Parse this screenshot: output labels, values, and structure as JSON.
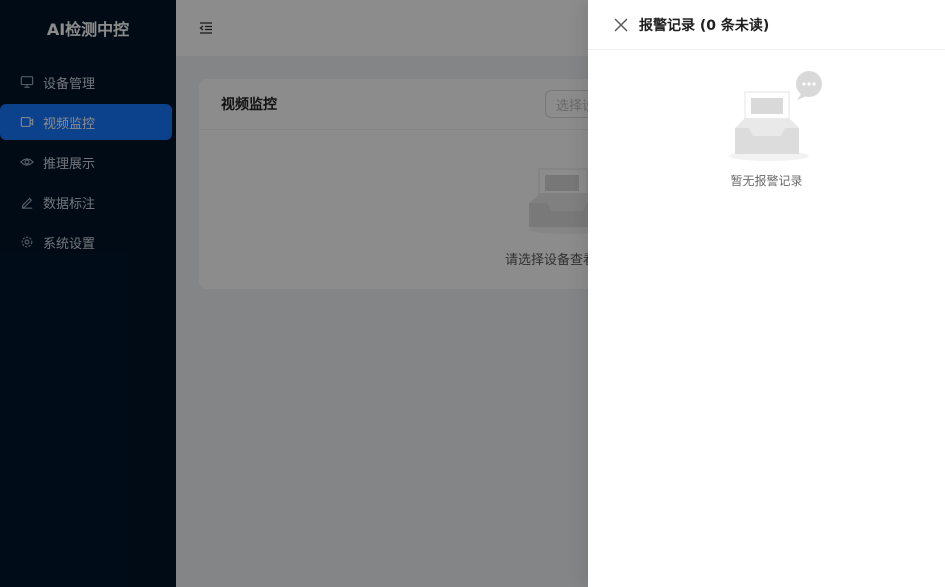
{
  "app": {
    "title": "AI检测中控"
  },
  "sidebar": {
    "items": [
      {
        "label": "设备管理",
        "icon": "monitor-icon",
        "active": false
      },
      {
        "label": "视频监控",
        "icon": "video-icon",
        "active": true
      },
      {
        "label": "推理展示",
        "icon": "eye-icon",
        "active": false
      },
      {
        "label": "数据标注",
        "icon": "edit-icon",
        "active": false
      },
      {
        "label": "系统设置",
        "icon": "gear-icon",
        "active": false
      }
    ]
  },
  "header": {
    "fold_icon": "menu-fold-icon"
  },
  "main": {
    "card_title": "视频监控",
    "select_placeholder": "选择设备",
    "empty_text": "请选择设备查看"
  },
  "drawer": {
    "title": "报警记录 (0 条未读)",
    "empty_text": "暂无报警记录",
    "close_icon": "close-icon"
  },
  "colors": {
    "sidebar_bg": "#001529",
    "accent": "#1677ff",
    "mask": "rgba(0,0,0,0.45)"
  }
}
